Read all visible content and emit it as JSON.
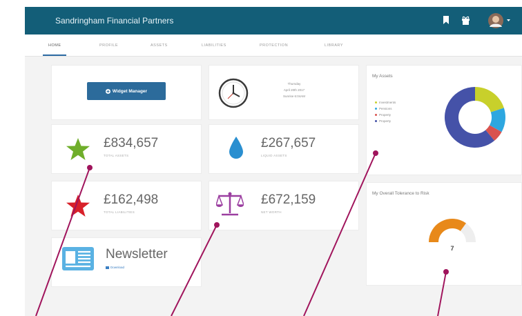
{
  "header": {
    "brand": "Sandringham Financial Partners",
    "icons": [
      "bookmark-icon",
      "gift-icon",
      "avatar"
    ]
  },
  "tabs": [
    {
      "label": "HOME",
      "active": true
    },
    {
      "label": "PROFILE",
      "active": false
    },
    {
      "label": "ASSETS",
      "active": false
    },
    {
      "label": "LIABILITIES",
      "active": false
    },
    {
      "label": "PROTECTION",
      "active": false
    },
    {
      "label": "LIBRARY",
      "active": false
    }
  ],
  "widget_manager": {
    "label": "Widget Manager",
    "icon": "plus-circle-icon"
  },
  "clock": {
    "line1": "Thursday",
    "line2": "April 20th 2017",
    "line3": "Sunrise 6:04AM"
  },
  "total_assets": {
    "value": "£834,657",
    "label": "TOTAL ASSETS",
    "icon": "star-icon",
    "color": "#6fae2a"
  },
  "liquid_assets": {
    "value": "£267,657",
    "label": "LIQUID ASSETS",
    "icon": "water-drop-icon",
    "color": "#2a8fd0"
  },
  "total_liabilities": {
    "value": "£162,498",
    "label": "TOTAL LIABILITIES",
    "icon": "star-icon",
    "color": "#d8212a"
  },
  "net_worth": {
    "value": "£672,159",
    "label": "NET WORTH",
    "icon": "scales-icon",
    "color": "#9b3ea0"
  },
  "newsletter": {
    "title": "Newsletter",
    "link": "Download",
    "icon": "newspaper-icon"
  },
  "my_assets": {
    "title": "My Assets",
    "legend": [
      {
        "label": "Investments",
        "color": "#c8d02b"
      },
      {
        "label": "Pensions",
        "color": "#2ea7e0"
      },
      {
        "label": "Property",
        "color": "#d9534f"
      },
      {
        "label": "Property",
        "color": "#4552a8"
      }
    ]
  },
  "chart_data": {
    "type": "pie",
    "categories": [
      "Investments",
      "Pensions",
      "Property",
      "Property"
    ],
    "values": [
      20,
      13,
      6,
      61
    ],
    "colors": [
      "#c8d02b",
      "#2ea7e0",
      "#d9534f",
      "#4552a8"
    ],
    "title": "My Assets",
    "donut": true,
    "legend": "left"
  },
  "risk": {
    "title": "My Overall Tolerance to Risk",
    "value": "7",
    "level": 0.7,
    "colors": {
      "fill": "#e8891a",
      "track": "#eeeeee"
    }
  }
}
